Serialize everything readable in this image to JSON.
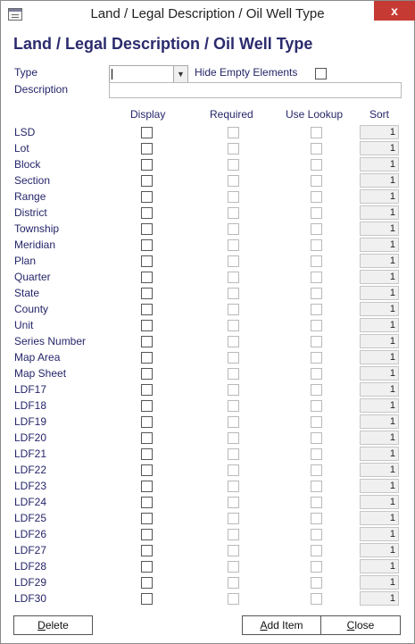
{
  "window": {
    "title": "Land / Legal Description / Oil Well Type",
    "close_glyph": "x"
  },
  "form": {
    "heading": "Land / Legal Description / Oil Well Type",
    "type_label": "Type",
    "type_value": "",
    "hide_empty_label": "Hide Empty Elements",
    "hide_empty_checked": false,
    "description_label": "Description",
    "description_value": ""
  },
  "columns": {
    "display": "Display",
    "required": "Required",
    "use_lookup": "Use Lookup",
    "sort": "Sort"
  },
  "rows": [
    {
      "label": "LSD",
      "sort": "1"
    },
    {
      "label": "Lot",
      "sort": "1"
    },
    {
      "label": "Block",
      "sort": "1"
    },
    {
      "label": "Section",
      "sort": "1"
    },
    {
      "label": "Range",
      "sort": "1"
    },
    {
      "label": "District",
      "sort": "1"
    },
    {
      "label": "Township",
      "sort": "1"
    },
    {
      "label": "Meridian",
      "sort": "1"
    },
    {
      "label": "Plan",
      "sort": "1"
    },
    {
      "label": "Quarter",
      "sort": "1"
    },
    {
      "label": "State",
      "sort": "1"
    },
    {
      "label": "County",
      "sort": "1"
    },
    {
      "label": "Unit",
      "sort": "1"
    },
    {
      "label": "Series Number",
      "sort": "1"
    },
    {
      "label": "Map Area",
      "sort": "1"
    },
    {
      "label": "Map Sheet",
      "sort": "1"
    },
    {
      "label": "LDF17",
      "sort": "1"
    },
    {
      "label": "LDF18",
      "sort": "1"
    },
    {
      "label": "LDF19",
      "sort": "1"
    },
    {
      "label": "LDF20",
      "sort": "1"
    },
    {
      "label": "LDF21",
      "sort": "1"
    },
    {
      "label": "LDF22",
      "sort": "1"
    },
    {
      "label": "LDF23",
      "sort": "1"
    },
    {
      "label": "LDF24",
      "sort": "1"
    },
    {
      "label": "LDF25",
      "sort": "1"
    },
    {
      "label": "LDF26",
      "sort": "1"
    },
    {
      "label": "LDF27",
      "sort": "1"
    },
    {
      "label": "LDF28",
      "sort": "1"
    },
    {
      "label": "LDF29",
      "sort": "1"
    },
    {
      "label": "LDF30",
      "sort": "1"
    }
  ],
  "buttons": {
    "delete_hotkey": "D",
    "delete_rest": "elete",
    "add_hotkey": "A",
    "add_rest": "dd Item",
    "close_hotkey": "C",
    "close_rest": "lose"
  },
  "icons": {
    "window_icon": "form-window-icon",
    "dropdown_icon": "chevron-down-icon"
  }
}
